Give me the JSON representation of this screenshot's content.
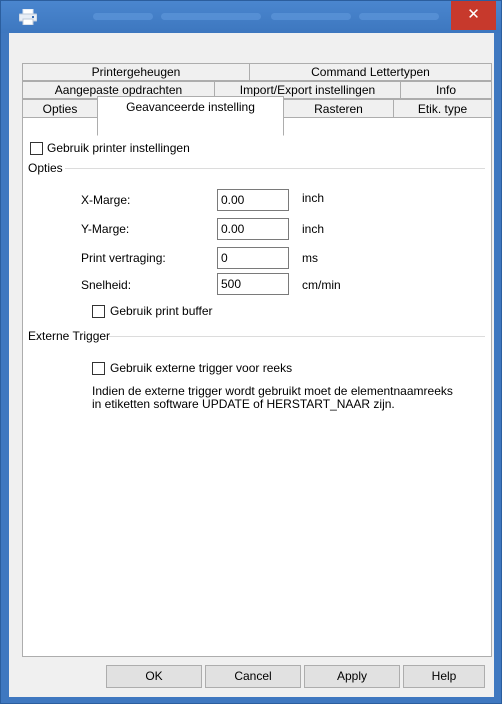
{
  "window": {
    "title": "",
    "close_glyph": "✕",
    "icon": "printer-icon"
  },
  "tabs": {
    "row1": [
      "Printergeheugen",
      "Command Lettertypen"
    ],
    "row2": [
      "Aangepaste opdrachten",
      "Import/Export instellingen",
      "Info"
    ],
    "row3": [
      "Opties",
      "Geavanceerde instelling",
      "Rasteren",
      "Etik. type"
    ],
    "active": "Geavanceerde instelling"
  },
  "page": {
    "use_printer_settings": {
      "label": "Gebruik printer instellingen",
      "checked": false
    },
    "options_group": "Opties",
    "fields": [
      {
        "label": "X-Marge:",
        "value": "0.00",
        "unit": "inch"
      },
      {
        "label": "Y-Marge:",
        "value": "0.00",
        "unit": "inch"
      },
      {
        "label": "Print vertraging:",
        "value": "0",
        "unit": "ms"
      },
      {
        "label": "Snelheid:",
        "value": "500",
        "unit": "cm/min"
      }
    ],
    "print_buffer": {
      "label": "Gebruik print buffer",
      "checked": false
    },
    "trigger_group": "Externe Trigger",
    "external_trigger": {
      "label": "Gebruik externe trigger voor reeks",
      "checked": false
    },
    "trigger_note_line1": "Indien de externe trigger wordt gebruikt moet de elementnaamreeks",
    "trigger_note_line2": "in etiketten software UPDATE of HERSTART_NAAR zijn."
  },
  "buttons": {
    "ok": "OK",
    "cancel": "Cancel",
    "apply": "Apply",
    "help": "Help"
  }
}
